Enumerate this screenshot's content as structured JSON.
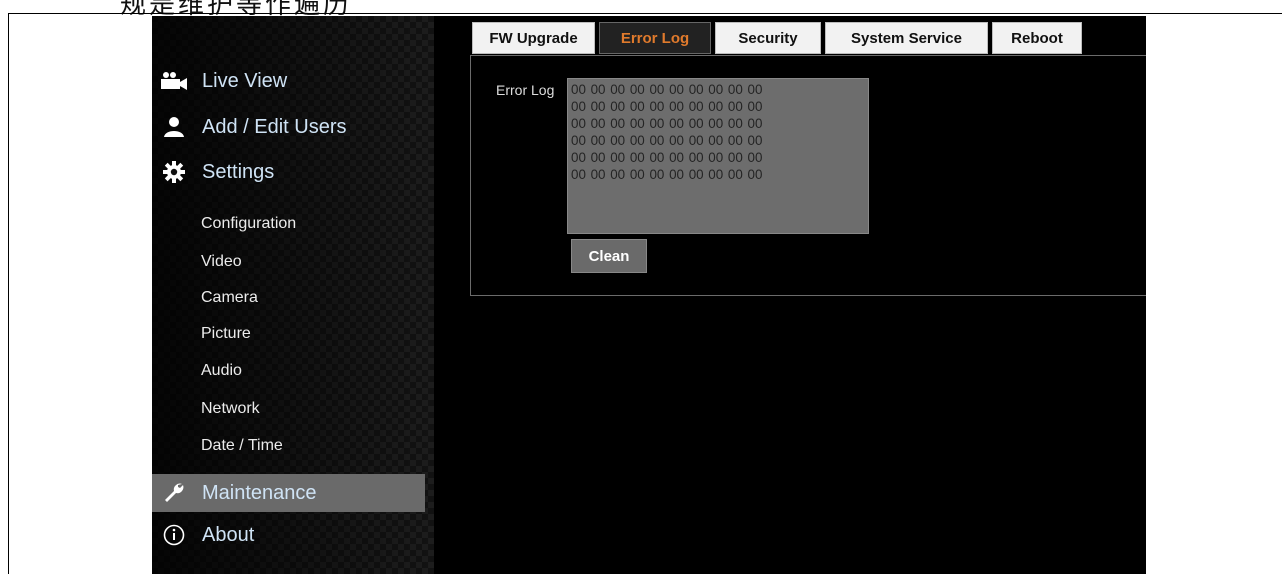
{
  "page_heading_fragment": "规是维护等作遍历",
  "sidebar": {
    "main": [
      {
        "label": "Live View",
        "icon": "camera-icon"
      },
      {
        "label": "Add / Edit Users",
        "icon": "user-icon"
      },
      {
        "label": "Settings",
        "icon": "gear-icon"
      },
      {
        "label": "Maintenance",
        "icon": "wrench-icon"
      },
      {
        "label": "About",
        "icon": "info-icon"
      }
    ],
    "sub": [
      "Configuration",
      "Video",
      "Camera",
      "Picture",
      "Audio",
      "Network",
      "Date / Time"
    ],
    "active": "Maintenance"
  },
  "tabs": [
    "FW Upgrade",
    "Error Log",
    "Security",
    "System Service",
    "Reboot"
  ],
  "active_tab": "Error Log",
  "error_log": {
    "label": "Error Log",
    "lines": [
      "00 00 00 00 00 00 00 00 00 00",
      "00 00 00 00 00 00 00 00 00 00",
      "00 00 00 00 00 00 00 00 00 00",
      "00 00 00 00 00 00 00 00 00 00",
      "00 00 00 00 00 00 00 00 00 00",
      "00 00 00 00 00 00 00 00 00 00"
    ],
    "clean_label": "Clean"
  },
  "colors": {
    "active_tab_text": "#e07a2c",
    "nav_text": "#cfe3f5",
    "active_nav_bg": "#6a6a6a"
  }
}
